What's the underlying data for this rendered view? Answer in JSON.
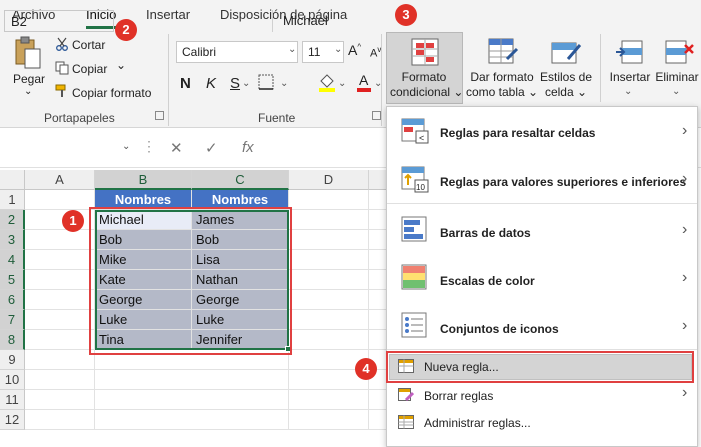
{
  "tabs": {
    "archivo": "Archivo",
    "inicio": "Inicio",
    "insertar": "Insertar",
    "disposicion": "Disposición de página"
  },
  "clipboard": {
    "pegar": "Pegar",
    "cortar": "Cortar",
    "copiar": "Copiar",
    "copiar_chevron": "⌄",
    "copiar_formato": "Copiar formato",
    "group_label": "Portapapeles"
  },
  "font": {
    "name": "Calibri",
    "size": "11",
    "bold": "N",
    "italic": "K",
    "underline": "S",
    "group_label": "Fuente"
  },
  "styles": {
    "formato_condicional_1": "Formato",
    "formato_condicional_2": "condicional ⌄",
    "dar_formato_1": "Dar formato",
    "dar_formato_2": "como tabla ⌄",
    "estilos_1": "Estilos de",
    "estilos_2": "celda ⌄"
  },
  "cells_group": {
    "insertar": "Insertar",
    "eliminar": "Eliminar"
  },
  "formula_bar": {
    "name_box": "B2",
    "fx": "fx",
    "value": "Michael"
  },
  "grid": {
    "columns": [
      "A",
      "B",
      "C",
      "D"
    ],
    "rows": [
      "1",
      "2",
      "3",
      "4",
      "5",
      "6",
      "7",
      "8",
      "9",
      "10",
      "11",
      "12"
    ],
    "header_b": "Nombres",
    "header_c": "Nombres",
    "col_b": [
      "Michael",
      "Bob",
      "Mike",
      "Kate",
      "George",
      "Luke",
      "Tina"
    ],
    "col_c": [
      "James",
      "Bob",
      "Lisa",
      "Nathan",
      "George",
      "Luke",
      "Jennifer"
    ]
  },
  "callouts": [
    "1",
    "2",
    "3",
    "4"
  ],
  "menu": {
    "reglas_resaltar": "Reglas para resaltar celdas",
    "reglas_superiores": "Reglas para valores superiores e inferiores",
    "barras": "Barras de datos",
    "escalas": "Escalas de color",
    "conjuntos": "Conjuntos de iconos",
    "nueva": "Nueva regla...",
    "borrar": "Borrar reglas",
    "administrar": "Administrar reglas..."
  },
  "colors": {
    "accent": "#217346",
    "header_blue": "#4472c4",
    "data_fill": "#b4b9c8",
    "callout_red": "#e03127"
  }
}
